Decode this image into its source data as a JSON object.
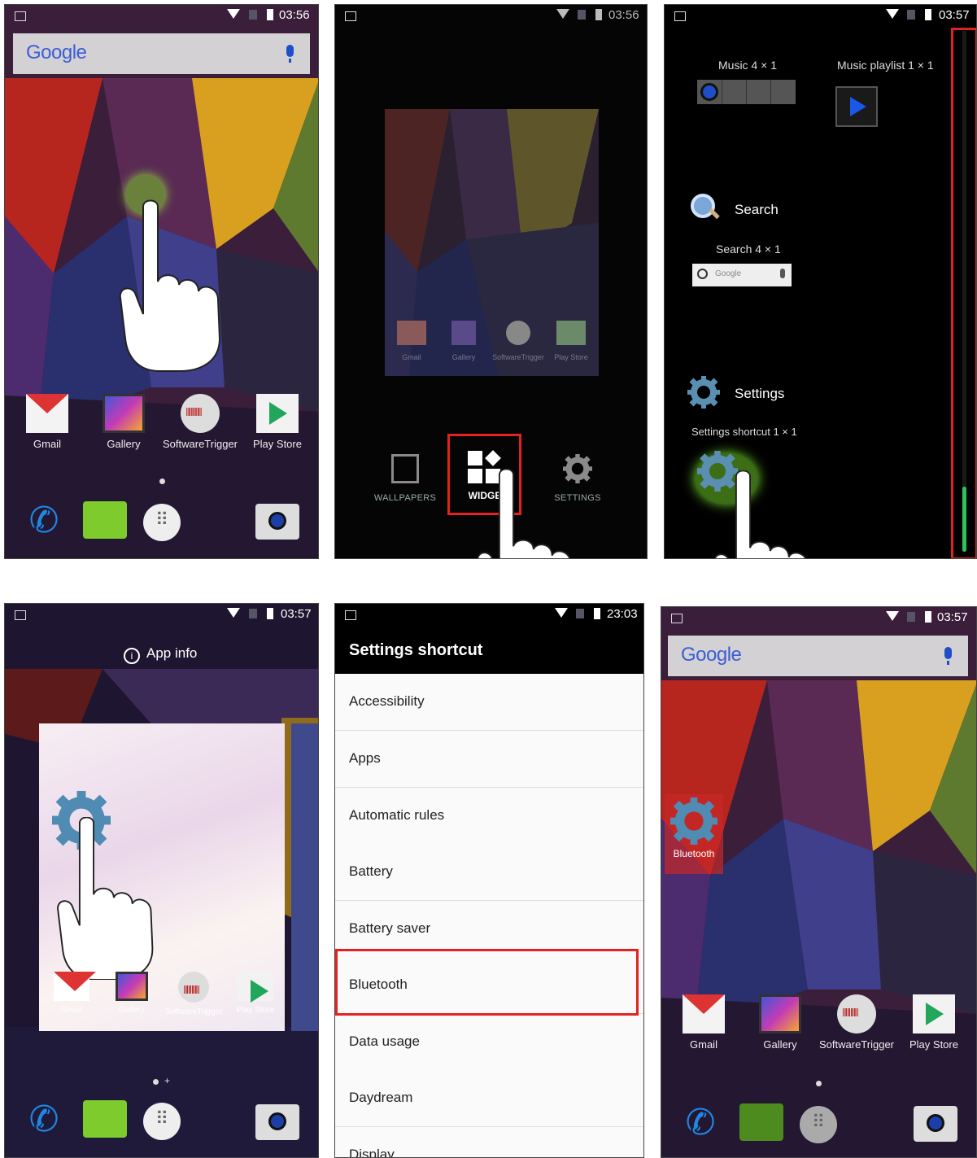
{
  "panels": {
    "p1": {
      "status_time": "03:56",
      "google_logo": "Google",
      "apps": [
        "Gmail",
        "Gallery",
        "SoftwareTrigger",
        "Play Store"
      ]
    },
    "p2": {
      "status_time": "03:56",
      "preview_apps": [
        "Gmail",
        "Gallery",
        "SoftwareTrigger",
        "Play Store"
      ],
      "bottom": {
        "wallpapers": "WALLPAPERS",
        "widgets": "WIDGE",
        "settings": "SETTINGS"
      }
    },
    "p3": {
      "status_time": "03:57",
      "widgets": {
        "music": "Music  4 × 1",
        "music_playlist": "Music playlist  1 × 1",
        "search_title": "Search",
        "search_sub": "Search  4 × 1",
        "search_preview": "Google",
        "settings_title": "Settings",
        "settings_sub": "Settings shortcut  1 × 1"
      }
    },
    "p4": {
      "status_time": "03:57",
      "app_info": "App info",
      "preview_apps": [
        "Gmail",
        "Gallery",
        "SoftwareTrigger",
        "Play Store"
      ]
    },
    "p5": {
      "status_time": "23:03",
      "title": "Settings shortcut",
      "items": [
        "Accessibility",
        "Apps",
        "Automatic rules",
        "Battery",
        "Battery saver",
        "Bluetooth",
        "Data usage",
        "Daydream",
        "Display"
      ]
    },
    "p6": {
      "status_time": "03:57",
      "google_logo": "Google",
      "bluetooth_label": "Bluetooth",
      "apps": [
        "Gmail",
        "Gallery",
        "SoftwareTrigger",
        "Play Store"
      ]
    }
  },
  "colors": {
    "highlight": "#e32121",
    "accent_blue": "#1f4ec9",
    "green": "#22a65b"
  }
}
